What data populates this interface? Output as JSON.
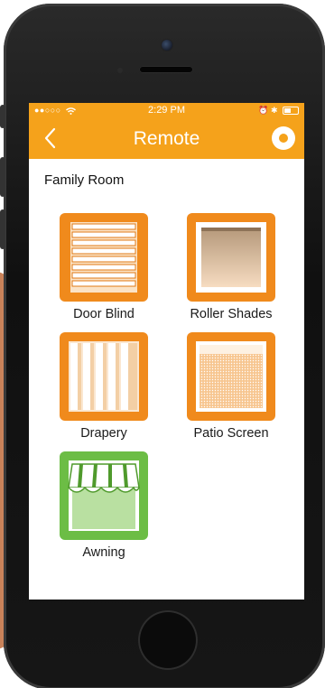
{
  "status_bar": {
    "signal": "●●○○○",
    "time": "2:29 PM",
    "bluetooth": "✱"
  },
  "nav": {
    "title": "Remote"
  },
  "room": {
    "name": "Family Room"
  },
  "devices": [
    {
      "label": "Door Blind",
      "icon": "door-blind-icon",
      "color": "#f08a1c"
    },
    {
      "label": "Roller Shades",
      "icon": "roller-shades-icon",
      "color": "#f08a1c"
    },
    {
      "label": "Drapery",
      "icon": "drapery-icon",
      "color": "#f08a1c"
    },
    {
      "label": "Patio Screen",
      "icon": "patio-screen-icon",
      "color": "#f08a1c"
    },
    {
      "label": "Awning",
      "icon": "awning-icon",
      "color": "#6cbd45"
    }
  ],
  "colors": {
    "accent": "#f5a21b",
    "tile_orange": "#f08a1c",
    "tile_green": "#6cbd45"
  }
}
